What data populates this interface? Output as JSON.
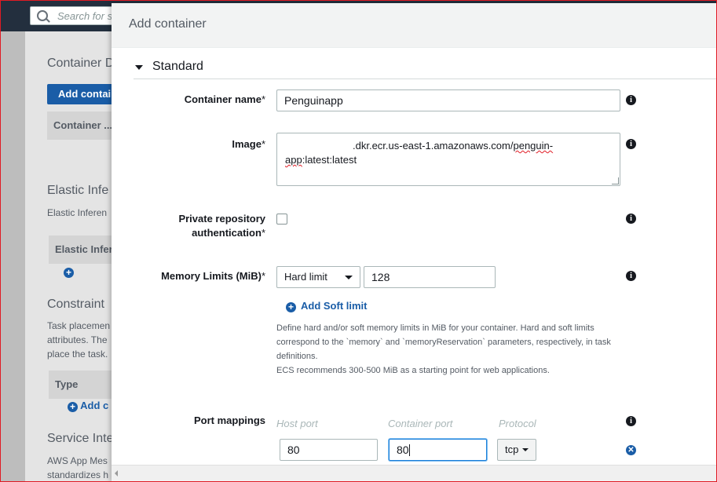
{
  "background": {
    "search_placeholder": "Search for s",
    "heading_container": "Container D",
    "add_container_button": "Add contai",
    "table_header_container": "Container ...",
    "heading_elastic": "Elastic Infe",
    "elastic_text": "Elastic Inferen",
    "elastic_table_header": "Elastic Infer",
    "heading_constraint": "Constraint",
    "constraint_text": [
      "Task placemen",
      "attributes. The",
      "place the task."
    ],
    "type_header": "Type",
    "add_constraint_link": "Add c",
    "heading_service": "Service Inte",
    "service_text": [
      "AWS App Mes",
      "standardizes h"
    ]
  },
  "modal": {
    "title": "Add container",
    "section": "Standard",
    "container_name": {
      "label": "Container name",
      "required": "*",
      "value": "Penguinapp"
    },
    "image": {
      "label": "Image",
      "required": "*",
      "value_part1": ".dkr.ecr.us-east-1.amazonaws.com/",
      "value_link": "penguin-",
      "value_line2_a": "app",
      "value_line2_b": ":latest:latest"
    },
    "private_repo": {
      "label_line1": "Private repository",
      "label_line2": "authentication",
      "required": "*"
    },
    "memory": {
      "label": "Memory Limits (MiB)",
      "required": "*",
      "limit_type": "Hard limit",
      "value": "128",
      "add_soft_link": "Add Soft limit"
    },
    "memory_help": [
      "Define hard and/or soft memory limits in MiB for your container. Hard and soft limits",
      "correspond to the `memory` and `memoryReservation` parameters, respectively, in task",
      "definitions.",
      "ECS recommends 300-500 MiB as a starting point for web applications."
    ],
    "ports": {
      "label": "Port mappings",
      "host_header": "Host port",
      "container_header": "Container port",
      "protocol_header": "Protocol",
      "host_value": "80",
      "container_value": "80",
      "protocol_value": "tcp"
    }
  },
  "colors": {
    "accent": "#1a5da7",
    "topbar": "#232f3e",
    "focus": "#1a7fd9"
  }
}
